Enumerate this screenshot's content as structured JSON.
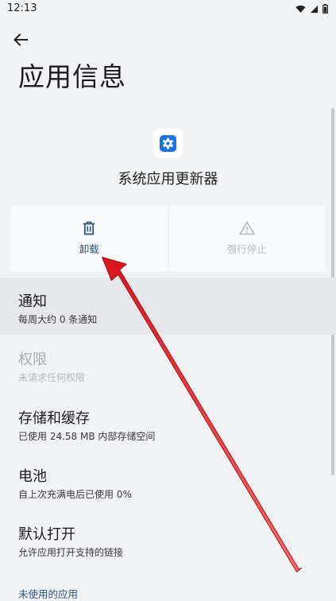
{
  "status_bar": {
    "time": "12:13"
  },
  "page": {
    "title": "应用信息"
  },
  "app": {
    "name": "系统应用更新器",
    "icon": "gear-icon"
  },
  "actions": [
    {
      "label": "卸载",
      "icon": "trash-icon",
      "enabled": true
    },
    {
      "label": "强行停止",
      "icon": "warning-icon",
      "enabled": false
    }
  ],
  "settings": [
    {
      "title": "通知",
      "subtitle": "每周大约 0 条通知"
    },
    {
      "title": "权限",
      "subtitle": "未请求任何权限"
    },
    {
      "title": "存储和缓存",
      "subtitle": "已使用 24.58 MB 内部存储空间"
    },
    {
      "title": "电池",
      "subtitle": "自上次充满电后已使用 0%"
    },
    {
      "title": "默认打开",
      "subtitle": "允许应用打开支持的链接"
    }
  ],
  "section": {
    "unused_apps": "未使用的应用"
  },
  "colors": {
    "accent": "#2a5586",
    "app_icon": "#1a73e8",
    "annotation_arrow": "#e8202a"
  }
}
